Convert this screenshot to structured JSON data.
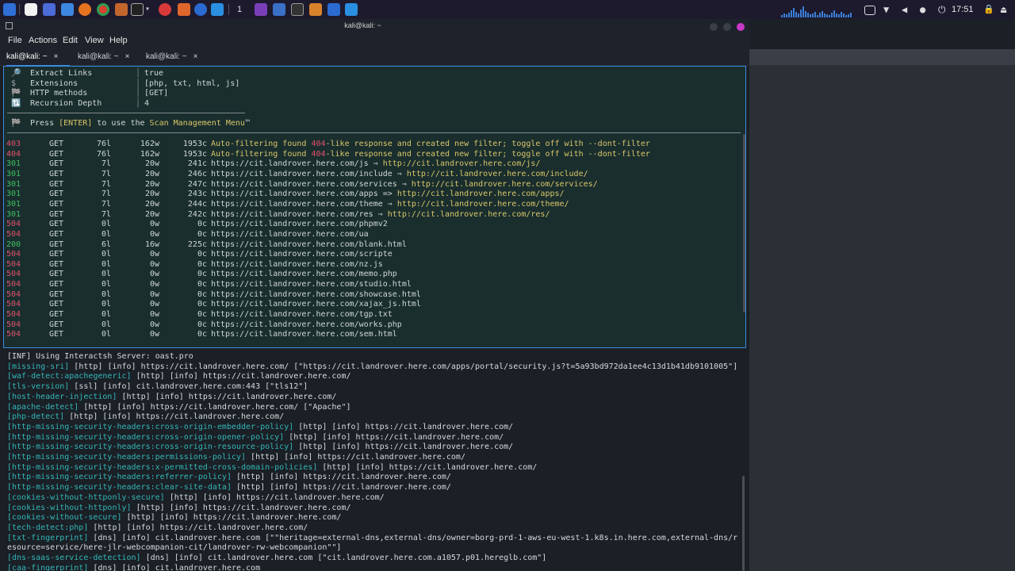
{
  "panel": {
    "clock": "17:51",
    "workspace": "1"
  },
  "window": {
    "title": "kali@kali: ~",
    "menu": [
      "File",
      "Actions",
      "Edit",
      "View",
      "Help"
    ],
    "tabs": [
      {
        "label": "kali@kali: ~",
        "active": true
      },
      {
        "label": "kali@kali: ~",
        "active": false
      },
      {
        "label": "kali@kali: ~",
        "active": false
      }
    ],
    "tab_close": "×"
  },
  "config": [
    {
      "icon": "🔎",
      "key": "Extract Links",
      "value": "true"
    },
    {
      "icon": "$",
      "key": "Extensions",
      "value": "[php, txt, html, js]"
    },
    {
      "icon": "🏁",
      "key": "HTTP methods",
      "value": "[GET]"
    },
    {
      "icon": "🔃",
      "key": "Recursion Depth",
      "value": "4"
    }
  ],
  "press_line": {
    "icon": "🏁",
    "prefix": "Press ",
    "enter": "[ENTER]",
    "middle": " to use the ",
    "menu": "Scan Management Menu",
    "suffix": "™"
  },
  "ferox_rows": [
    {
      "code": "403",
      "method": "GET",
      "lines": "76l",
      "words": "162w",
      "chars": "1953c",
      "kind": "filter",
      "url": "Auto-filtering found ",
      "hl": "404",
      "rest": "-like response and created new filter; toggle off with --dont-filter"
    },
    {
      "code": "404",
      "method": "GET",
      "lines": "76l",
      "words": "162w",
      "chars": "1953c",
      "kind": "filter",
      "url": "Auto-filtering found ",
      "hl": "404",
      "rest": "-like response and created new filter; toggle off with --dont-filter"
    },
    {
      "code": "301",
      "method": "GET",
      "lines": "7l",
      "words": "20w",
      "chars": "241c",
      "kind": "redir",
      "url": "https://cit.landrover.here.com/js",
      "arrow": " ⇒ ",
      "target": "http://cit.landrover.here.com/js/"
    },
    {
      "code": "301",
      "method": "GET",
      "lines": "7l",
      "words": "20w",
      "chars": "246c",
      "kind": "redir",
      "url": "https://cit.landrover.here.com/include",
      "arrow": " ⇒ ",
      "target": "http://cit.landrover.here.com/include/"
    },
    {
      "code": "301",
      "method": "GET",
      "lines": "7l",
      "words": "20w",
      "chars": "247c",
      "kind": "redir",
      "url": "https://cit.landrover.here.com/services",
      "arrow": " ⇒ ",
      "target": "http://cit.landrover.here.com/services/"
    },
    {
      "code": "301",
      "method": "GET",
      "lines": "7l",
      "words": "20w",
      "chars": "243c",
      "kind": "redir",
      "url": "https://cit.landrover.here.com/apps",
      "arrow": " => ",
      "target": "http://cit.landrover.here.com/apps/"
    },
    {
      "code": "301",
      "method": "GET",
      "lines": "7l",
      "words": "20w",
      "chars": "244c",
      "kind": "redir",
      "url": "https://cit.landrover.here.com/theme",
      "arrow": " ⇒ ",
      "target": "http://cit.landrover.here.com/theme/"
    },
    {
      "code": "301",
      "method": "GET",
      "lines": "7l",
      "words": "20w",
      "chars": "242c",
      "kind": "redir",
      "url": "https://cit.landrover.here.com/res",
      "arrow": " ⇒ ",
      "target": "http://cit.landrover.here.com/res/"
    },
    {
      "code": "504",
      "method": "GET",
      "lines": "0l",
      "words": "0w",
      "chars": "0c",
      "kind": "plain",
      "url": "https://cit.landrover.here.com/phpmv2"
    },
    {
      "code": "504",
      "method": "GET",
      "lines": "0l",
      "words": "0w",
      "chars": "0c",
      "kind": "plain",
      "url": "https://cit.landrover.here.com/ua"
    },
    {
      "code": "200",
      "method": "GET",
      "lines": "6l",
      "words": "16w",
      "chars": "225c",
      "kind": "plain",
      "url": "https://cit.landrover.here.com/blank.html"
    },
    {
      "code": "504",
      "method": "GET",
      "lines": "0l",
      "words": "0w",
      "chars": "0c",
      "kind": "plain",
      "url": "https://cit.landrover.here.com/scripte"
    },
    {
      "code": "504",
      "method": "GET",
      "lines": "0l",
      "words": "0w",
      "chars": "0c",
      "kind": "plain",
      "url": "https://cit.landrover.here.com/nz.js"
    },
    {
      "code": "504",
      "method": "GET",
      "lines": "0l",
      "words": "0w",
      "chars": "0c",
      "kind": "plain",
      "url": "https://cit.landrover.here.com/memo.php"
    },
    {
      "code": "504",
      "method": "GET",
      "lines": "0l",
      "words": "0w",
      "chars": "0c",
      "kind": "plain",
      "url": "https://cit.landrover.here.com/studio.html"
    },
    {
      "code": "504",
      "method": "GET",
      "lines": "0l",
      "words": "0w",
      "chars": "0c",
      "kind": "plain",
      "url": "https://cit.landrover.here.com/showcase.html"
    },
    {
      "code": "504",
      "method": "GET",
      "lines": "0l",
      "words": "0w",
      "chars": "0c",
      "kind": "plain",
      "url": "https://cit.landrover.here.com/xajax_js.html"
    },
    {
      "code": "504",
      "method": "GET",
      "lines": "0l",
      "words": "0w",
      "chars": "0c",
      "kind": "plain",
      "url": "https://cit.landrover.here.com/tgp.txt"
    },
    {
      "code": "504",
      "method": "GET",
      "lines": "0l",
      "words": "0w",
      "chars": "0c",
      "kind": "plain",
      "url": "https://cit.landrover.here.com/works.php"
    },
    {
      "code": "504",
      "method": "GET",
      "lines": "0l",
      "words": "0w",
      "chars": "0c",
      "kind": "plain",
      "url": "https://cit.landrover.here.com/sem.html"
    }
  ],
  "nuclei_lines": [
    [
      [
        "[INF] Using Interactsh Server: oast.pro",
        "w"
      ]
    ],
    [
      [
        "[missing-sri]",
        "c"
      ],
      [
        " [http] [info] ",
        "w"
      ],
      [
        "https://cit.landrover.here.com/",
        "w"
      ],
      [
        " [\"https://cit.landrover.here.com/apps/portal/security.js?t=5a93bd972da1ee4c13d1b41db9101005\"]",
        "w"
      ]
    ],
    [
      [
        "[waf-detect:apachegeneric]",
        "c"
      ],
      [
        " [http] [info] https://cit.landrover.here.com/",
        "w"
      ]
    ],
    [
      [
        "[tls-version]",
        "c"
      ],
      [
        " [ssl] [info] cit.landrover.here.com:443 [\"tls12\"]",
        "w"
      ]
    ],
    [
      [
        "[host-header-injection]",
        "c"
      ],
      [
        " [http] [info] https://cit.landrover.here.com/",
        "w"
      ]
    ],
    [
      [
        "[apache-detect]",
        "c"
      ],
      [
        " [http] [info] https://cit.landrover.here.com/ [\"Apache\"]",
        "w"
      ]
    ],
    [
      [
        "[php-detect]",
        "c"
      ],
      [
        " [http] [info] https://cit.landrover.here.com/",
        "w"
      ]
    ],
    [
      [
        "[http-missing-security-headers:cross-origin-embedder-policy]",
        "c"
      ],
      [
        " [http] [info] https://cit.landrover.here.com/",
        "w"
      ]
    ],
    [
      [
        "[http-missing-security-headers:cross-origin-opener-policy]",
        "c"
      ],
      [
        " [http] [info] https://cit.landrover.here.com/",
        "w"
      ]
    ],
    [
      [
        "[http-missing-security-headers:cross-origin-resource-policy]",
        "c"
      ],
      [
        " [http] [info] https://cit.landrover.here.com/",
        "w"
      ]
    ],
    [
      [
        "[http-missing-security-headers:permissions-policy]",
        "c"
      ],
      [
        " [http] [info] https://cit.landrover.here.com/",
        "w"
      ]
    ],
    [
      [
        "[http-missing-security-headers:x-permitted-cross-domain-policies]",
        "c"
      ],
      [
        " [http] [info] https://cit.landrover.here.com/",
        "w"
      ]
    ],
    [
      [
        "[http-missing-security-headers:referrer-policy]",
        "c"
      ],
      [
        " [http] [info] https://cit.landrover.here.com/",
        "w"
      ]
    ],
    [
      [
        "[http-missing-security-headers:clear-site-data]",
        "c"
      ],
      [
        " [http] [info] https://cit.landrover.here.com/",
        "w"
      ]
    ],
    [
      [
        "[cookies-without-httponly-secure]",
        "c"
      ],
      [
        " [http] [info] https://cit.landrover.here.com/",
        "w"
      ]
    ],
    [
      [
        "[cookies-without-httponly]",
        "c"
      ],
      [
        " [http] [info] https://cit.landrover.here.com/",
        "w"
      ]
    ],
    [
      [
        "[cookies-without-secure]",
        "c"
      ],
      [
        " [http] [info] https://cit.landrover.here.com/",
        "w"
      ]
    ],
    [
      [
        "[tech-detect:php]",
        "c"
      ],
      [
        " [http] [info] https://cit.landrover.here.com/",
        "w"
      ]
    ],
    [
      [
        "[txt-fingerprint]",
        "c"
      ],
      [
        " [dns] [info] cit.landrover.here.com [\"\"heritage=external-dns,external-dns/owner=borg-prd-1-aws-eu-west-1.k8s.in.here.com,external-dns/r",
        "w"
      ]
    ],
    [
      [
        "esource=service/here-jlr-webcompanion-cit/landrover-rw-webcompanion\"\"]",
        "w"
      ]
    ],
    [
      [
        "[dns-saas-service-detection]",
        "c"
      ],
      [
        " [dns] [info] cit.landrover.here.com [\"cit.landrover.here.com.a1057.p01.hereglb.com\"]",
        "w"
      ]
    ],
    [
      [
        "[caa-fingerprint]",
        "c"
      ],
      [
        " [dns] [info] cit.landrover.here.com",
        "w"
      ]
    ]
  ],
  "colors": {
    "accent": "#3b8be0",
    "ok": "#3fbf5f",
    "error": "#e0506a",
    "link": "#d8c76a",
    "template": "#32b8b8"
  }
}
